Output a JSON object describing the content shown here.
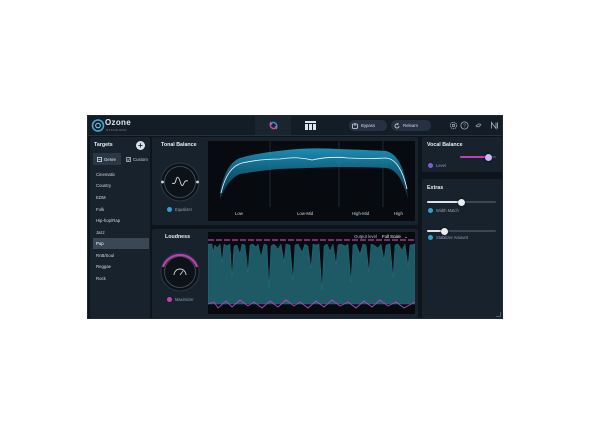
{
  "app": {
    "logo_text": "Ozone",
    "logo_sub": "STANDARD"
  },
  "topbar": {
    "bypass_label": "Bypass",
    "relearn_label": "Relearn"
  },
  "targets": {
    "title": "Targets",
    "tabs": [
      {
        "label": "Genre",
        "active": true
      },
      {
        "label": "Custom",
        "active": false
      }
    ],
    "genres": [
      "Cinematic",
      "Country",
      "EDM",
      "Folk",
      "Hip-hop/Rap",
      "Jazz",
      "Pop",
      "RnB/Soul",
      "Reggae",
      "Rock"
    ],
    "selected": "Pop"
  },
  "tonal_balance": {
    "title": "Tonal Balance",
    "module_label": "Equalizer",
    "bands": [
      "Low",
      "Low-Mid",
      "High-Mid",
      "High"
    ]
  },
  "loudness": {
    "title": "Loudness",
    "module_label": "Maximizer",
    "output_level_label": "Output level",
    "output_level_value": "Full Scale"
  },
  "vocal_balance": {
    "title": "Vocal Balance",
    "level_label": "Level",
    "level_value": 0.8
  },
  "extras": {
    "title": "Extras",
    "width_match_label": "Width Match",
    "width_match_value": 0.5,
    "stabilizer_label": "Stabilizer Amount",
    "stabilizer_value": 0.25
  },
  "colors": {
    "accent_cyan": "#34c6e8",
    "accent_magenta": "#c03fb2",
    "panel_bg": "#18222c"
  },
  "icons": [
    "ozone-logo-icon",
    "assistant-view-icon",
    "grid-view-icon",
    "bypass-icon",
    "relearn-icon",
    "settings-icon",
    "help-icon",
    "ozone-swirl-icon",
    "ni-logo-icon",
    "plus-icon",
    "genre-icon",
    "custom-check-icon",
    "power-icon",
    "chevron-down-icon",
    "resize-grip-icon"
  ]
}
